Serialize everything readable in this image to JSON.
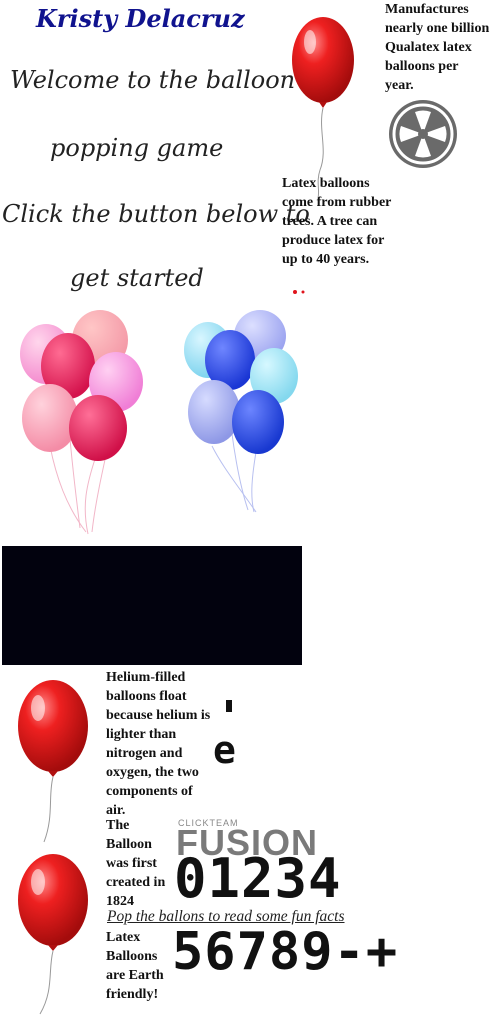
{
  "header": {
    "player_name": "Kristy Delacruz"
  },
  "welcome": {
    "line1": "Welcome to the balloon",
    "line2": "popping game",
    "line3": "Click the button below to",
    "line4": "get started"
  },
  "facts": {
    "manufactures": "Manufactures nearly one billion Qualatex latex balloons per year.",
    "latex_trees": "Latex balloons come from rubber trees. A tree can produce latex for up to 40 years.",
    "helium": "Helium-filled balloons float because helium is lighter than nitrogen and oxygen, the two components of air.",
    "first_created": "The Balloon was first created in 1824",
    "earth_friendly": "Latex Balloons are Earth friendly!"
  },
  "game": {
    "instruction": "Pop the ballons to read some fun facts",
    "digits_row1": "01234",
    "digits_row2": "56789-+",
    "stray_char": "e",
    "fusion_brand_small": "CLICKTEAM",
    "fusion_brand_big": "FUSION"
  },
  "colors": {
    "name_blue": "#10138e",
    "balloon_red": "#e0141c",
    "pink_cluster": [
      "#f7a8d8",
      "#ee2a63",
      "#ffb0c0",
      "#f58fe0"
    ],
    "blue_cluster": [
      "#8ad9f0",
      "#2446e0",
      "#a8b4f4",
      "#9a9ce8"
    ],
    "logo_gray": "#6a6a6a",
    "video_black": "#02020e"
  },
  "icons": {
    "logo": "clickteam-logo-icon",
    "balloon": "red-balloon-icon"
  }
}
